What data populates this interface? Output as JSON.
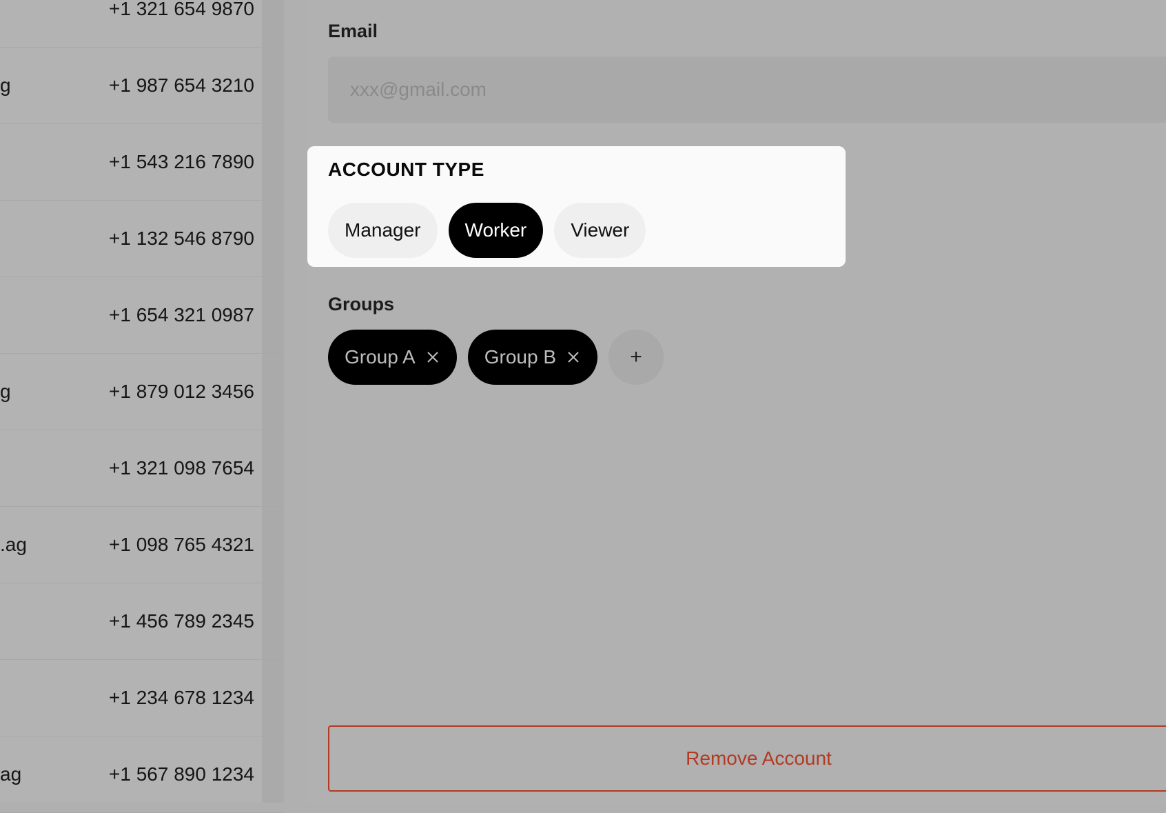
{
  "contacts": [
    {
      "email_fragment": "",
      "phone": "+1 321 654 9870"
    },
    {
      "email_fragment": "g",
      "phone": "+1 987 654 3210"
    },
    {
      "email_fragment": "",
      "phone": "+1 543 216 7890"
    },
    {
      "email_fragment": "",
      "phone": "+1 132 546 8790"
    },
    {
      "email_fragment": "",
      "phone": "+1 654 321 0987"
    },
    {
      "email_fragment": "g",
      "phone": "+1 879 012 3456"
    },
    {
      "email_fragment": "",
      "phone": "+1 321 098 7654"
    },
    {
      "email_fragment": ".ag",
      "phone": "+1 098 765 4321"
    },
    {
      "email_fragment": "",
      "phone": "+1 456 789 2345"
    },
    {
      "email_fragment": "",
      "phone": "+1 234 678 1234"
    },
    {
      "email_fragment": "ag",
      "phone": "+1 567 890 1234"
    }
  ],
  "detail": {
    "email_label": "Email",
    "email_placeholder": "xxx@gmail.com",
    "email_value": "",
    "account_type": {
      "title": "ACCOUNT TYPE",
      "options": [
        "Manager",
        "Worker",
        "Viewer"
      ],
      "selected": "Worker"
    },
    "groups_label": "Groups",
    "groups": [
      "Group A",
      "Group B"
    ],
    "add_group_label": "+",
    "remove_button_label": "Remove Account"
  },
  "icons": {
    "chip_remove": "close-icon",
    "add_group": "plus-icon"
  },
  "colors": {
    "overlay_dim": "#b1b1b1",
    "highlight_card": "#fafafa",
    "selected_option": "#000000",
    "danger": "#b23a23"
  }
}
